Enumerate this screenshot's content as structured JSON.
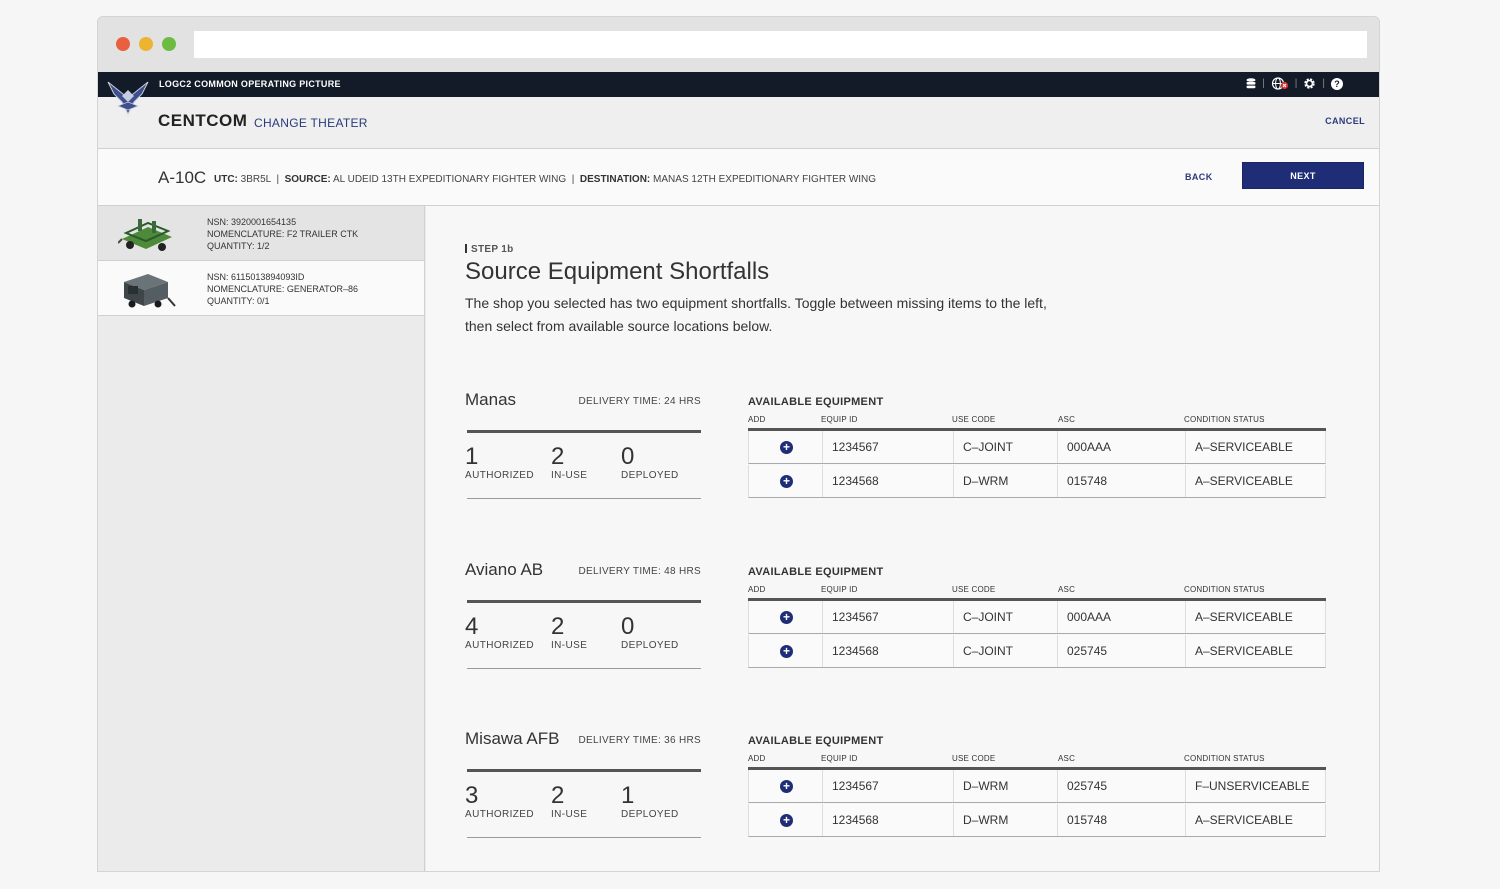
{
  "header": {
    "app_title": "LOGC2 COMMON OPERATING PICTURE",
    "theater": "CENTCOM",
    "change_theater": "CHANGE THEATER",
    "cancel": "CANCEL",
    "icons": [
      "database-icon",
      "globe-icon",
      "gear-icon",
      "help-icon"
    ],
    "help_glyph": "?"
  },
  "infobar": {
    "aircraft": "A-10C",
    "utc_label": "UTC:",
    "utc": "3BR5L",
    "source_label": "SOURCE:",
    "source": "AL UDEID 13TH EXPEDITIONARY FIGHTER WING",
    "destination_label": "DESTINATION:",
    "destination": "MANAS 12TH EXPEDITIONARY FIGHTER WING",
    "back": "BACK",
    "next": "NEXT"
  },
  "sidebar": {
    "items": [
      {
        "nsn": "NSN: 3920001654135",
        "nomenclature": "NOMENCLATURE: F2 TRAILER CTK",
        "quantity": "QUANTITY: 1/2",
        "image": "trailer-image"
      },
      {
        "nsn": "NSN: 6115013894093ID",
        "nomenclature": "NOMENCLATURE:  GENERATOR–86",
        "quantity": "QUANTITY: 0/1",
        "image": "generator-image"
      }
    ]
  },
  "main": {
    "step": "STEP 1b",
    "title": "Source Equipment Shortfalls",
    "description": "The shop you selected has two equipment shortfalls. Toggle between missing items to the left, then select from available source locations below.",
    "headers": {
      "available": "AVAILABLE EQUIPMENT",
      "add": "ADD",
      "equip_id": "EQUIP ID",
      "use_code": "USE CODE",
      "asc": "ASC",
      "condition": "CONDITION STATUS"
    },
    "stat_labels": {
      "authorized": "AUTHORIZED",
      "in_use": "IN-USE",
      "deployed": "DEPLOYED"
    },
    "locations": [
      {
        "name": "Manas",
        "delivery": "DELIVERY TIME:  24 HRS",
        "authorized": "1",
        "in_use": "2",
        "deployed": "0",
        "rows": [
          {
            "equip_id": "1234567",
            "use_code": "C–JOINT",
            "asc": "000AAA",
            "condition": "A–SERVICEABLE"
          },
          {
            "equip_id": "1234568",
            "use_code": "D–WRM",
            "asc": "015748",
            "condition": "A–SERVICEABLE"
          }
        ]
      },
      {
        "name": "Aviano AB",
        "delivery": "DELIVERY TIME:  48 HRS",
        "authorized": "4",
        "in_use": "2",
        "deployed": "0",
        "rows": [
          {
            "equip_id": "1234567",
            "use_code": "C–JOINT",
            "asc": "000AAA",
            "condition": "A–SERVICEABLE"
          },
          {
            "equip_id": "1234568",
            "use_code": "C–JOINT",
            "asc": "025745",
            "condition": "A–SERVICEABLE"
          }
        ]
      },
      {
        "name": "Misawa AFB",
        "delivery": "DELIVERY TIME:  36 HRS",
        "authorized": "3",
        "in_use": "2",
        "deployed": "1",
        "rows": [
          {
            "equip_id": "1234567",
            "use_code": "D–WRM",
            "asc": "025745",
            "condition": "F–UNSERVICEABLE"
          },
          {
            "equip_id": "1234568",
            "use_code": "D–WRM",
            "asc": "015748",
            "condition": "A–SERVICEABLE"
          }
        ]
      }
    ]
  },
  "colors": {
    "accent": "#1f2d77",
    "topbar": "#121b27",
    "link": "#2a3a7c"
  }
}
